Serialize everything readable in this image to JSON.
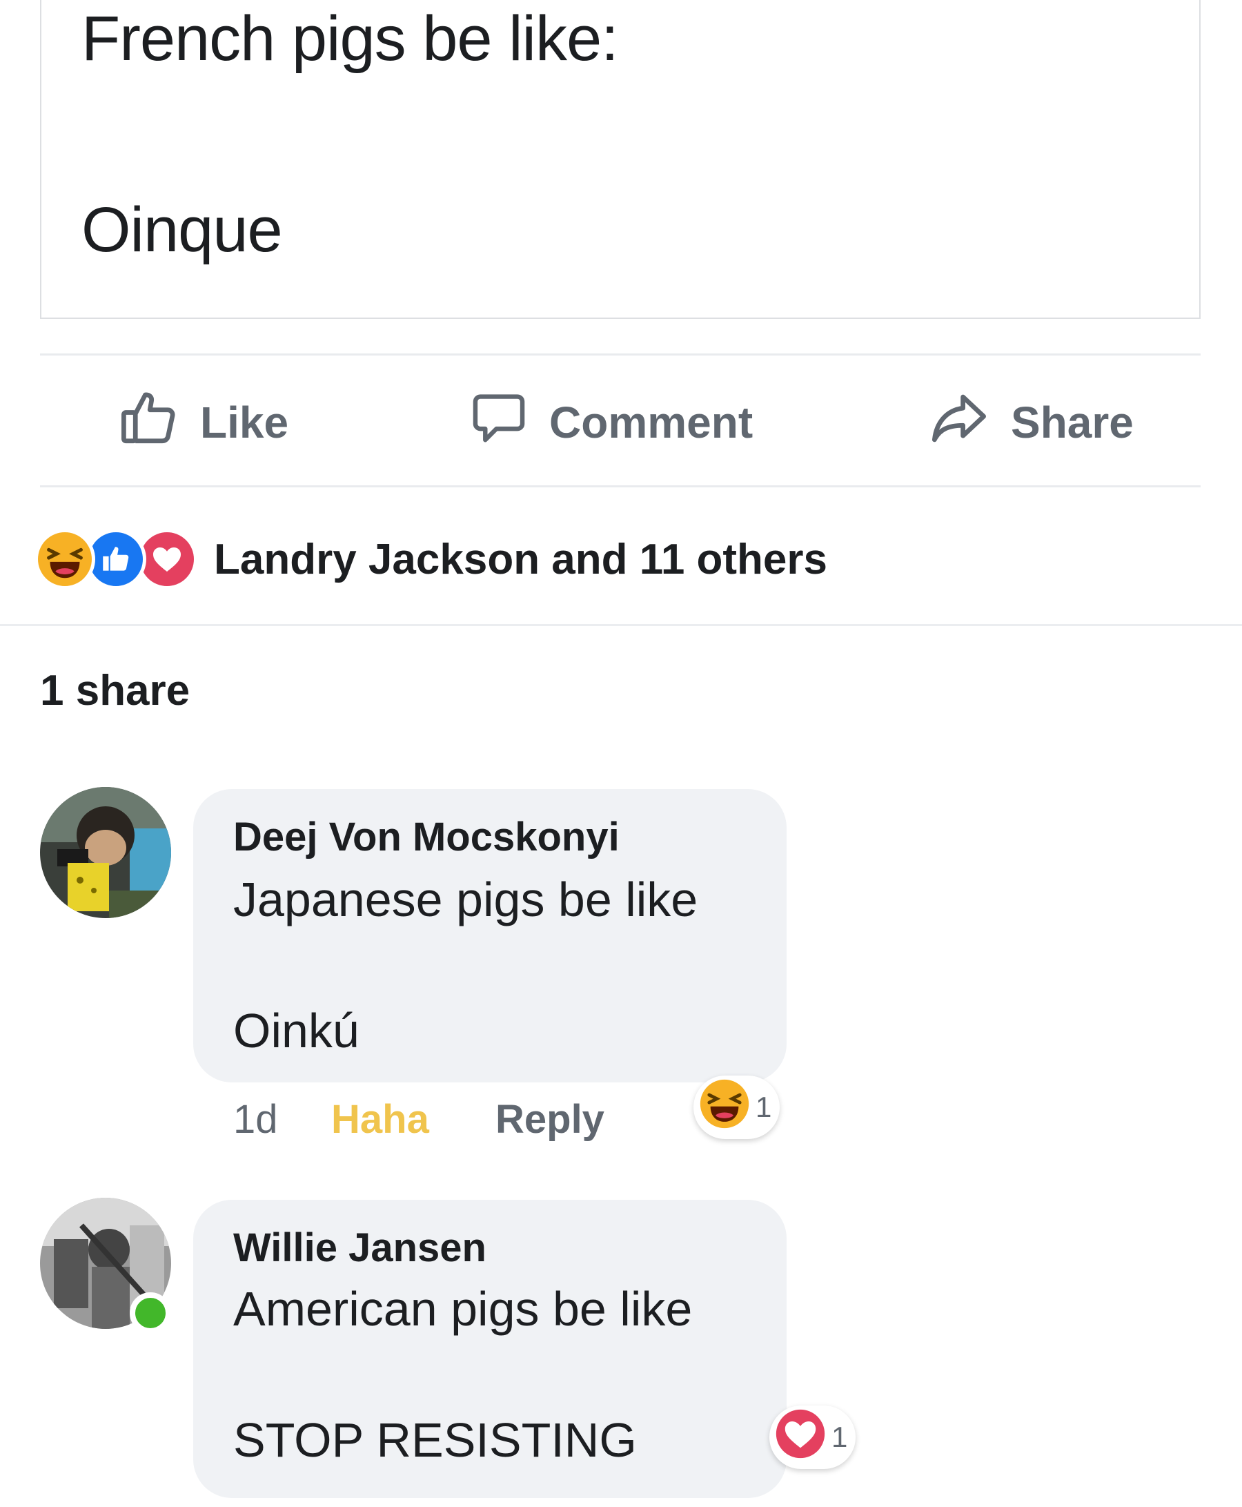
{
  "post": {
    "line1": "French pigs be like:",
    "line2": "Oinque"
  },
  "actions": {
    "like": "Like",
    "comment": "Comment",
    "share": "Share"
  },
  "reactions": {
    "summary": "Landry Jackson and 11 others",
    "icons": [
      "haha-icon",
      "like-icon",
      "love-icon"
    ]
  },
  "shares": "1 share",
  "comments": [
    {
      "author": "Deej Von Mocskonyi",
      "line1": "Japanese pigs be like",
      "line2": "Oinkú",
      "time": "1d",
      "reaction_label": "Haha",
      "reply_label": "Reply",
      "reaction_icon": "haha-icon",
      "reaction_count": "1"
    },
    {
      "author": "Willie Jansen",
      "line1": "American pigs be like",
      "line2": "STOP RESISTING",
      "reaction_icon": "love-icon",
      "reaction_count": "1",
      "online": true
    }
  ],
  "colors": {
    "text": "#1c1e21",
    "secondary": "#606770",
    "like_blue": "#1877f2",
    "love_red": "#e4405f",
    "haha_yellow": "#f7b125",
    "haha_label": "#f0c44d",
    "bubble": "#f0f2f5",
    "online_green": "#42b72a"
  }
}
